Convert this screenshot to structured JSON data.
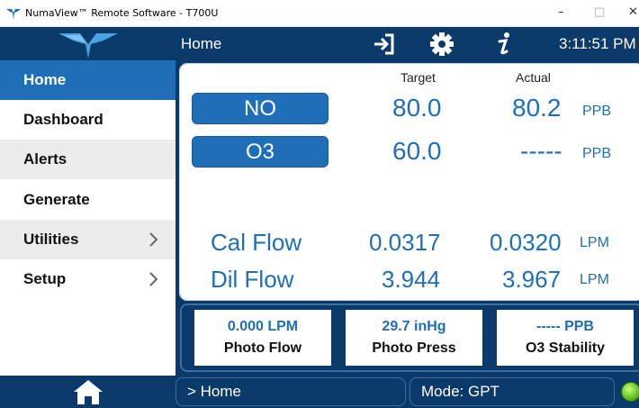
{
  "window": {
    "title": "NumaView™ Remote Software - T700U",
    "minimize": "–",
    "maximize": "□",
    "close": "✕"
  },
  "header": {
    "title": "Home",
    "clock": "3:11:51 PM",
    "icons": [
      "sign-in-icon",
      "gear-icon",
      "info-icon"
    ]
  },
  "sidebar": {
    "items": [
      {
        "label": "Home",
        "active": true
      },
      {
        "label": "Dashboard"
      },
      {
        "label": "Alerts"
      },
      {
        "label": "Generate"
      },
      {
        "label": "Utilities",
        "has_submenu": true
      },
      {
        "label": "Setup",
        "has_submenu": true
      }
    ]
  },
  "main": {
    "col_target": "Target",
    "col_actual": "Actual",
    "gases": [
      {
        "name": "NO",
        "target": "80.0",
        "actual": "80.2",
        "unit": "PPB"
      },
      {
        "name": "O3",
        "target": "60.0",
        "actual": "-----",
        "unit": "PPB"
      }
    ],
    "flows": [
      {
        "name": "Cal Flow",
        "target": "0.0317",
        "actual": "0.0320",
        "unit": "LPM"
      },
      {
        "name": "Dil Flow",
        "target": "3.944",
        "actual": "3.967",
        "unit": "LPM"
      }
    ]
  },
  "tiles": [
    {
      "value": "0.000 LPM",
      "label": "Photo Flow"
    },
    {
      "value": "29.7 inHg",
      "label": "Photo Press"
    },
    {
      "value": "----- PPB",
      "label": "O3 Stability"
    }
  ],
  "footer": {
    "breadcrumb": "> Home",
    "mode": "Mode: GPT"
  },
  "colors": {
    "navy": "#0a3a6a",
    "accent_blue": "#1e6fb8",
    "status_green": "#5ebd1f"
  }
}
